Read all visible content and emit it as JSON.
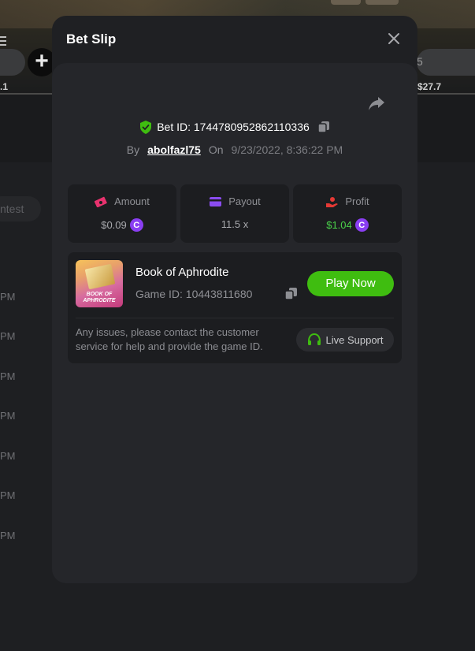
{
  "background": {
    "left_value": ".1",
    "right_value": "$27.7",
    "right_pill_text": "5",
    "contest_label": "ntest",
    "time_labels": [
      "PM",
      "PM",
      "PM",
      "PM",
      "PM",
      "PM",
      "PM"
    ]
  },
  "modal": {
    "title": "Bet Slip",
    "bet_id_label": "Bet ID: 1744780952862110336",
    "by_label": "By",
    "username": "abolfazl75",
    "on_label": "On",
    "date": "9/23/2022, 8:36:22 PM",
    "stats": {
      "amount": {
        "label": "Amount",
        "value": "$0.09",
        "icon": "money-icon",
        "color": "#e8326e"
      },
      "payout": {
        "label": "Payout",
        "value": "11.5 x",
        "icon": "card-icon",
        "color": "#8a4cf0"
      },
      "profit": {
        "label": "Profit",
        "value": "$1.04",
        "icon": "hand-coin-icon",
        "color": "#e53935",
        "value_color": "#4ad14a"
      }
    },
    "currency_icon": "coin-icon",
    "currency_glyph": "C",
    "game": {
      "name": "Book of Aphrodite",
      "id_label": "Game ID: 10443811680",
      "thumb_text": "BOOK OF APHRODITE",
      "play_label": "Play Now"
    },
    "issues_text": "Any issues, please contact the customer service for help and provide the game ID.",
    "support_label": "Live Support"
  },
  "colors": {
    "accent_green": "#3fbd10",
    "modal_bg": "#1f2023",
    "panel_bg": "#1c1d20",
    "shield_green": "#3fbd10"
  }
}
